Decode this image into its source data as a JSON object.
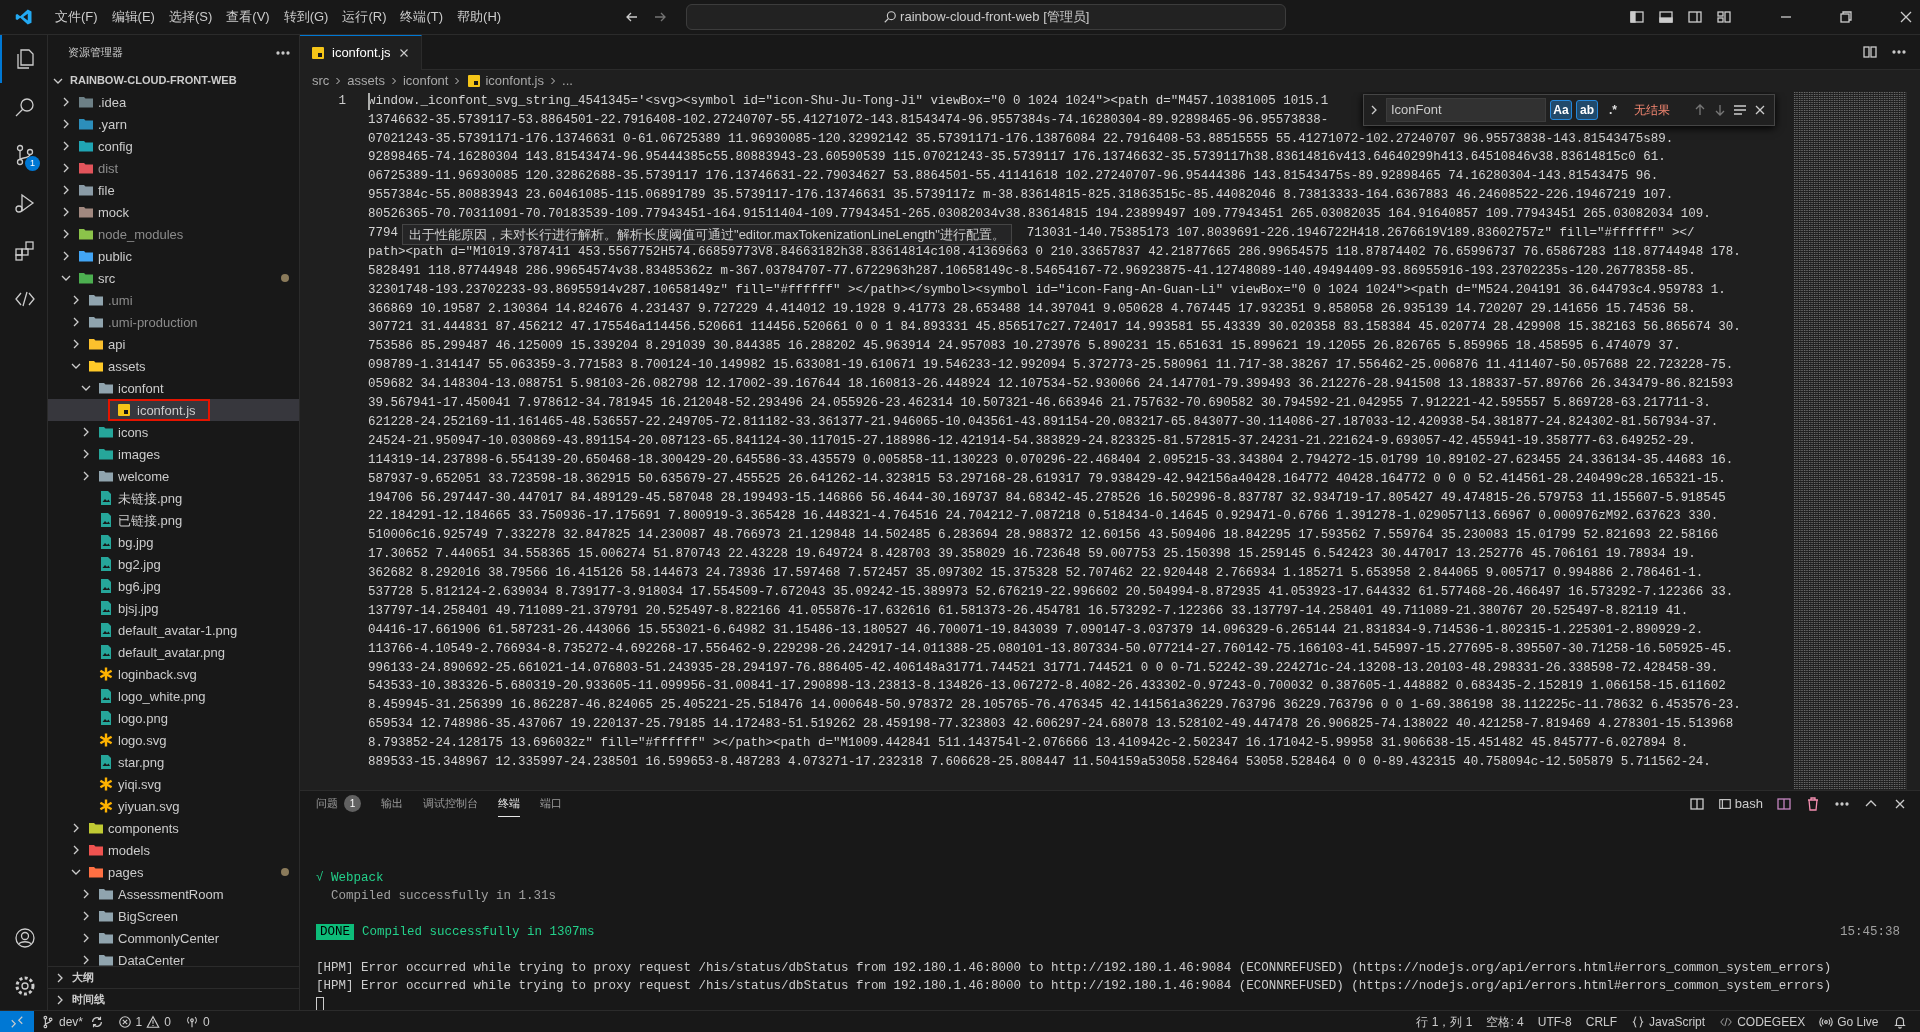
{
  "title_bar": {
    "menu": [
      "文件(F)",
      "编辑(E)",
      "选择(S)",
      "查看(V)",
      "转到(G)",
      "运行(R)",
      "终端(T)",
      "帮助(H)"
    ],
    "search": "rainbow-cloud-front-web [管理员]"
  },
  "activity_bar": {
    "items": [
      {
        "kind": "explorer",
        "selected": true
      },
      {
        "kind": "search",
        "selected": false
      },
      {
        "kind": "source_control",
        "selected": false,
        "badge": "1"
      },
      {
        "kind": "run",
        "selected": false
      },
      {
        "kind": "extensions",
        "selected": false
      },
      {
        "kind": "codegeex",
        "selected": false
      }
    ],
    "bottom": [
      {
        "kind": "account"
      },
      {
        "kind": "settings"
      }
    ]
  },
  "sidebar": {
    "title": "资源管理器",
    "root": "RAINBOW-CLOUD-FRONT-WEB",
    "tree": [
      {
        "label": ".idea",
        "kind": "folder",
        "color": "#6d8086",
        "expanded": false,
        "dimmed": false,
        "modified": false,
        "selected": false
      },
      {
        "label": ".yarn",
        "kind": "folder",
        "color": "#2c8ebb",
        "expanded": false,
        "dimmed": false,
        "modified": false,
        "selected": false
      },
      {
        "label": "config",
        "kind": "folder",
        "color": "#20a5b4",
        "expanded": false,
        "dimmed": false,
        "modified": false,
        "selected": false
      },
      {
        "label": "dist",
        "kind": "folder",
        "color": "#e2545b",
        "expanded": false,
        "dimmed": true,
        "modified": false,
        "selected": false
      },
      {
        "label": "file",
        "kind": "folder",
        "color": "#8a9ba6",
        "expanded": false,
        "dimmed": false,
        "modified": false,
        "selected": false
      },
      {
        "label": "mock",
        "kind": "folder",
        "color": "#a1887f",
        "expanded": false,
        "dimmed": false,
        "modified": false,
        "selected": false
      },
      {
        "label": "node_modules",
        "kind": "folder",
        "color": "#8bc34a",
        "expanded": false,
        "dimmed": true,
        "modified": false,
        "selected": false
      },
      {
        "label": "public",
        "kind": "folder",
        "color": "#42a5f5",
        "expanded": false,
        "dimmed": false,
        "modified": false,
        "selected": false
      },
      {
        "label": "src",
        "kind": "folder",
        "color": "#4caf50",
        "expanded": true,
        "dimmed": false,
        "modified": true,
        "selected": false,
        "children": [
          {
            "label": ".umi",
            "kind": "folder",
            "color": "#90a4ae",
            "expanded": false,
            "dimmed": true,
            "modified": false,
            "selected": false
          },
          {
            "label": ".umi-production",
            "kind": "folder",
            "color": "#90a4ae",
            "expanded": false,
            "dimmed": true,
            "modified": false,
            "selected": false
          },
          {
            "label": "api",
            "kind": "folder",
            "color": "#fbc02d",
            "expanded": false,
            "dimmed": false,
            "modified": false,
            "selected": false
          },
          {
            "label": "assets",
            "kind": "folder",
            "color": "#ffca28",
            "expanded": true,
            "dimmed": false,
            "modified": false,
            "selected": false,
            "children": [
              {
                "label": "iconfont",
                "kind": "folder",
                "color": "#90a4ae",
                "expanded": true,
                "dimmed": false,
                "modified": false,
                "selected": false,
                "children": [
                  {
                    "label": "iconfont.js",
                    "kind": "js",
                    "dimmed": false,
                    "modified": false,
                    "selected": true,
                    "annotated": true
                  }
                ]
              },
              {
                "label": "icons",
                "kind": "folder",
                "color": "#26a69a",
                "expanded": false,
                "dimmed": false,
                "modified": false,
                "selected": false
              },
              {
                "label": "images",
                "kind": "folder",
                "color": "#26a69a",
                "expanded": false,
                "dimmed": false,
                "modified": false,
                "selected": false
              },
              {
                "label": "welcome",
                "kind": "folder",
                "color": "#90a4ae",
                "expanded": false,
                "dimmed": false,
                "modified": false,
                "selected": false
              },
              {
                "label": "未链接.png",
                "kind": "image",
                "dimmed": false,
                "modified": false,
                "selected": false
              },
              {
                "label": "已链接.png",
                "kind": "image",
                "dimmed": false,
                "modified": false,
                "selected": false
              },
              {
                "label": "bg.jpg",
                "kind": "image",
                "dimmed": false,
                "modified": false,
                "selected": false
              },
              {
                "label": "bg2.jpg",
                "kind": "image",
                "dimmed": false,
                "modified": false,
                "selected": false
              },
              {
                "label": "bg6.jpg",
                "kind": "image",
                "dimmed": false,
                "modified": false,
                "selected": false
              },
              {
                "label": "bjsj.jpg",
                "kind": "image",
                "dimmed": false,
                "modified": false,
                "selected": false
              },
              {
                "label": "default_avatar-1.png",
                "kind": "image",
                "dimmed": false,
                "modified": false,
                "selected": false
              },
              {
                "label": "default_avatar.png",
                "kind": "image",
                "dimmed": false,
                "modified": false,
                "selected": false
              },
              {
                "label": "loginback.svg",
                "kind": "svg",
                "dimmed": false,
                "modified": false,
                "selected": false
              },
              {
                "label": "logo_white.png",
                "kind": "image",
                "dimmed": false,
                "modified": false,
                "selected": false
              },
              {
                "label": "logo.png",
                "kind": "image",
                "dimmed": false,
                "modified": false,
                "selected": false
              },
              {
                "label": "logo.svg",
                "kind": "svg",
                "dimmed": false,
                "modified": false,
                "selected": false
              },
              {
                "label": "star.png",
                "kind": "image",
                "dimmed": false,
                "modified": false,
                "selected": false
              },
              {
                "label": "yiqi.svg",
                "kind": "svg",
                "dimmed": false,
                "modified": false,
                "selected": false
              },
              {
                "label": "yiyuan.svg",
                "kind": "svg",
                "dimmed": false,
                "modified": false,
                "selected": false
              }
            ]
          },
          {
            "label": "components",
            "kind": "folder",
            "color": "#c0ca33",
            "expanded": false,
            "dimmed": false,
            "modified": false,
            "selected": false
          },
          {
            "label": "models",
            "kind": "folder",
            "color": "#ef5350",
            "expanded": false,
            "dimmed": false,
            "modified": false,
            "selected": false
          },
          {
            "label": "pages",
            "kind": "folder",
            "color": "#ff7043",
            "expanded": true,
            "dimmed": false,
            "modified": true,
            "selected": false,
            "children": [
              {
                "label": "AssessmentRoom",
                "kind": "folder",
                "color": "#90a4ae",
                "expanded": false,
                "dimmed": false,
                "modified": false,
                "selected": false
              },
              {
                "label": "BigScreen",
                "kind": "folder",
                "color": "#90a4ae",
                "expanded": false,
                "dimmed": false,
                "modified": false,
                "selected": false
              },
              {
                "label": "CommonlyCenter",
                "kind": "folder",
                "color": "#90a4ae",
                "expanded": false,
                "dimmed": false,
                "modified": false,
                "selected": false
              },
              {
                "label": "DataCenter",
                "kind": "folder",
                "color": "#90a4ae",
                "expanded": false,
                "dimmed": false,
                "modified": false,
                "selected": false
              }
            ]
          }
        ]
      }
    ],
    "sections": [
      {
        "label": "大纲",
        "expanded": false
      },
      {
        "label": "时间线",
        "expanded": false
      }
    ]
  },
  "editor": {
    "tabs": [
      {
        "label": "iconfont.js",
        "selected": true
      }
    ],
    "breadcrumbs": [
      "src",
      "assets",
      "iconfont",
      "iconfont.js",
      "..."
    ],
    "line_number": "1",
    "rows": [
      {
        "text": "window._iconfont_svg_string_4541345='<svg><symbol id=\"icon-Shu-Ju-Tong-Ji\" viewBox=\"0 0 1024 1024\"><path d=\"M457.10381005 1015.1"
      },
      {
        "text": "13746632-35.5739117-53.8864501-22.7916408-102.27240707-55.41271072-143.81543474-96.9557384s-74.16280304-89.92898465-96.95573838-"
      },
      {
        "text": "07021243-35.57391171-176.13746631 0-61.06725389 11.96930085-120.32992142 35.57391171-176.13876084 22.7916408-53.88515555 55.41271072-102.27240707 96.95573838-143.81543475s89."
      },
      {
        "text": "92898465-74.16280304 143.81543474-96.95444385c55.80883943-23.60590539 115.07021243-35.5739117 176.13746632-35.5739117h38.83614816v413.64640299h413.64510846v38.83614815c0 61."
      },
      {
        "text": "06725389-11.96930085 120.32862688-35.5739117 176.13746631-22.79034627 53.8864501-55.41141618 102.27240707-96.95444386 143.81543475s-89.92898465 74.16280304-143.81543475 96."
      },
      {
        "text": "9557384c-55.80883943 23.60461085-115.06891789 35.5739117-176.13746631 35.5739117z m-38.83614815-825.31863515c-85.44082046 8.73813333-164.6367883 46.24608522-226.19467219 107."
      },
      {
        "text": "80526365-70.70311091-70.70183539-109.77943451-164.91511404-109.77943451-265.03082034v38.83614815 194.23899497 109.77943451 265.03082035 164.91640857 109.77943451 265.03082034 109."
      },
      {
        "text": "7794",
        "continues": "713031-140.75385173 107.8039691-226.1946722H418.2676619V189.83602757z\" fill=\"#ffffff\" ></"
      },
      {
        "text": "path><path d=\"M1019.3787411 453.5567752H574.66859773V8.84663182h38.83614814c108.41369663 0 210.33657837 42.21877665 286.99654575 118.87874402 76.65996737 76.65867283 118.87744948 178."
      },
      {
        "text": "5828491 118.87744948 286.99654574v38.83485362z m-367.03784707-77.6722963h287.10658149c-8.54654167-72.96923875-41.12748089-140.49494409-93.86955916-193.23702235s-120.26778358-85."
      },
      {
        "text": "32301748-193.23702233-93.86955914v287.10658149z\" fill=\"#ffffff\" ></path></symbol><symbol id=\"icon-Fang-An-Guan-Li\" viewBox=\"0 0 1024 1024\"><path d=\"M524.204191 36.644793c4.959783 1."
      },
      {
        "text": "366869 10.19587 2.130364 14.824676 4.231437 9.727229 4.414012 19.1928 9.41773 28.653488 14.397041 9.050628 4.767445 17.932351 9.858058 26.935139 14.720207 29.141656 15.74536 58."
      },
      {
        "text": "307721 31.444831 87.456212 47.175546a114456.520661 114456.520661 0 0 1 84.893331 45.856517c27.724017 14.993581 55.43339 30.020358 83.158384 45.020774 28.429908 15.382163 56.865674 30."
      },
      {
        "text": "753586 85.299487 46.125009 15.339204 8.291039 30.844385 16.288202 45.963914 24.957083 10.273976 5.890231 15.651631 15.899621 19.12055 26.826765 5.859965 18.458595 6.474079 37."
      },
      {
        "text": "098789-1.314147 55.063359-3.771583 8.700124-10.149982 15.633081-19.610671 19.546233-12.992094 5.372773-25.580961 11.717-38.38267 17.556462-25.006876 11.411407-50.057688 22.723228-75."
      },
      {
        "text": "059682 34.148304-13.088751 5.98103-26.082798 12.17002-39.167644 18.160813-26.448924 12.107534-52.930066 24.147701-79.399493 36.212276-28.941508 13.188337-57.89766 26.343479-86.821593"
      },
      {
        "text": "39.567941-17.450041 7.978612-34.781945 16.212048-52.293496 24.055926-23.462314 10.507321-46.663946 21.757632-70.690582 30.794592-21.042955 7.912221-42.595557 5.869728-63.217711-3."
      },
      {
        "text": "621228-24.252169-11.161465-48.536557-22.249705-72.811182-33.361377-21.946065-10.043561-43.891154-20.083217-65.843077-30.114086-27.187033-12.420938-54.381877-24.824302-81.567934-37."
      },
      {
        "text": "24524-21.950947-10.030869-43.891154-20.087123-65.841124-30.117015-27.188986-12.421914-54.383829-24.823325-81.572815-37.24231-21.221624-9.693057-42.455941-19.358777-63.649252-29."
      },
      {
        "text": "114319-14.237898-6.554139-20.650468-18.300429-20.645586-33.435579 0.005858-11.130223 0.070296-22.468404 2.095215-33.343804 2.794272-15.01799 10.89102-27.623455 24.336134-35.44683 16."
      },
      {
        "text": "587937-9.652051 33.723598-18.362915 50.635679-27.455525 26.641262-14.323815 53.297168-28.619317 79.938429-42.942156a40428.164772 40428.164772 0 0 0 52.414561-28.240499c28.165321-15."
      },
      {
        "text": "194706 56.297447-30.447017 84.489129-45.587048 28.199493-15.146866 56.4644-30.169737 84.68342-45.278526 16.502996-8.837787 32.934719-17.805427 49.474815-26.579753 11.155607-5.918545"
      },
      {
        "text": "22.184291-12.184665 33.750936-17.175691 7.800919-3.365428 16.448321-4.764516 24.704212-7.087218 0.518434-0.14645 0.929471-0.6766 1.391278-1.029057l13.66967 0.000976zM92.637623 330."
      },
      {
        "text": "510006c16.925749 7.332278 32.847825 14.230087 48.766973 21.129848 14.502485 6.283694 28.988372 12.60156 43.509406 18.842295 17.593562 7.559764 35.230083 15.01799 52.821693 22.58166"
      },
      {
        "text": "17.30652 7.440651 34.558365 15.006274 51.870743 22.43228 19.649724 8.428703 39.358029 16.723648 59.007753 25.150398 15.259145 6.542423 30.447017 13.252776 45.706161 19.78934 19."
      },
      {
        "text": "362682 8.292016 38.79566 16.415126 58.144673 24.73936 17.597468 7.572457 35.097302 15.375328 52.707462 22.920448 2.766934 1.185271 5.653958 2.844065 9.005717 0.994886 2.786461-1."
      },
      {
        "text": "537728 5.812124-2.639034 8.739177-3.918034 17.554509-7.672043 35.09242-15.389973 52.676219-22.996602 20.504994-8.872935 41.053923-17.644332 61.577468-26.466497 16.573292-7.122366 33."
      },
      {
        "text": "137797-14.258401 49.711089-21.379791 20.525497-8.822166 41.055876-17.632616 61.581373-26.454781 16.573292-7.122366 33.137797-14.258401 49.711089-21.380767 20.525497-8.82119 41."
      },
      {
        "text": "04416-17.661906 61.587231-26.443066 15.553021-6.64982 31.15486-13.180527 46.700071-19.843039 7.090147-3.037379 14.096329-6.265144 21.831834-9.714536-1.802315-1.225301-2.890929-2."
      },
      {
        "text": "113766-4.10549-2.766934-8.735272-4.692268-17.556462-9.229298-26.242917-14.011388-25.080101-13.807334-50.077214-27.760142-75.166103-41.545997-15.277695-8.395507-30.71258-16.505925-45."
      },
      {
        "text": "996133-24.890692-25.661021-14.076803-51.243935-28.294197-76.886405-42.406148a31771.744521 31771.744521 0 0 0-71.52242-39.224271c-24.13208-13.20103-48.298331-26.338598-72.428458-39."
      },
      {
        "text": "543533-10.383326-5.680319-20.933605-11.099956-31.00841-17.290898-13.23813-8.134826-13.067272-8.4082-26.433302-0.97243-0.700032 0.387605-1.448882 0.683435-2.152819 1.066158-15.611602"
      },
      {
        "text": "8.459945-31.256399 16.862287-46.824065 25.405221-25.518476 14.000648-50.978372 28.105765-76.476345 42.141561a36229.763796 36229.763796 0 0 1-69.386198 38.112225c-11.78632 6.453576-23."
      },
      {
        "text": "659534 12.748986-35.437067 19.220137-25.79185 14.172483-51.519262 28.459198-77.323803 42.606297-24.68078 13.528102-49.447478 26.906825-74.138022 40.421258-7.819469 4.278301-15.513968"
      },
      {
        "text": "8.793852-24.128175 13.696032z\" fill=\"#ffffff\" ></path><path d=\"M1009.442841 511.143754l-2.076666 13.410942c-2.502347 16.171042-5.99958 31.906638-15.451482 45.845777-6.027894 8."
      },
      {
        "text": "889533-15.348967 12.335997-24.238501 16.599653-8.487283 4.073271-17.232318 7.606628-25.808447 11.504159a53058.528464 53058.528464 0 0 0-89.432315 40.758094c-12.505879 5.711562-24."
      }
    ],
    "hover_message": "出于性能原因，未对长行进行解析。解析长度阈值可通过\"editor.maxTokenizationLineLength\"进行配置。",
    "find": {
      "query": "IconFont",
      "options": [
        {
          "label": "Aa",
          "on": true
        },
        {
          "label": "ab",
          "on": true
        },
        {
          "label": ".*",
          "on": false
        }
      ],
      "result": "无结果"
    }
  },
  "panel": {
    "tabs": [
      {
        "label": "问题",
        "badge": "1",
        "selected": false
      },
      {
        "label": "输出",
        "selected": false
      },
      {
        "label": "调试控制台",
        "selected": false
      },
      {
        "label": "终端",
        "selected": true
      },
      {
        "label": "端口",
        "selected": false
      }
    ],
    "shell": "bash",
    "lines": [
      {
        "kind": "heading",
        "text": "√ Webpack"
      },
      {
        "kind": "detail",
        "text": "  Compiled successfully in 1.31s"
      },
      {
        "kind": "done",
        "badge": "DONE",
        "text": "Compiled successfully in 1307ms",
        "time": "15:45:38"
      },
      {
        "kind": "plain",
        "text": "[HPM] Error occurred while trying to proxy request /his/status/dbStatus from 192.180.1.46:8000 to http://192.180.1.46:9084 (ECONNREFUSED) (https://nodejs.org/api/errors.html#errors_common_system_errors)"
      },
      {
        "kind": "plain",
        "text": "[HPM] Error occurred while trying to proxy request /his/status/dbStatus from 192.180.1.46:8000 to http://192.180.1.46:9084 (ECONNREFUSED) (https://nodejs.org/api/errors.html#errors_common_system_errors)"
      }
    ]
  },
  "status_bar": {
    "branch": "dev*",
    "errors": "1",
    "warnings": "0",
    "ports": "0",
    "right": [
      {
        "kind": "text",
        "text": "行 1，列 1"
      },
      {
        "kind": "text",
        "text": "空格: 4"
      },
      {
        "kind": "text",
        "text": "UTF-8"
      },
      {
        "kind": "text",
        "text": "CRLF"
      },
      {
        "kind": "language",
        "text": "JavaScript"
      },
      {
        "kind": "codegeex",
        "text": "CODEGEEX"
      },
      {
        "kind": "live",
        "text": "Go Live"
      },
      {
        "kind": "bell"
      }
    ]
  }
}
